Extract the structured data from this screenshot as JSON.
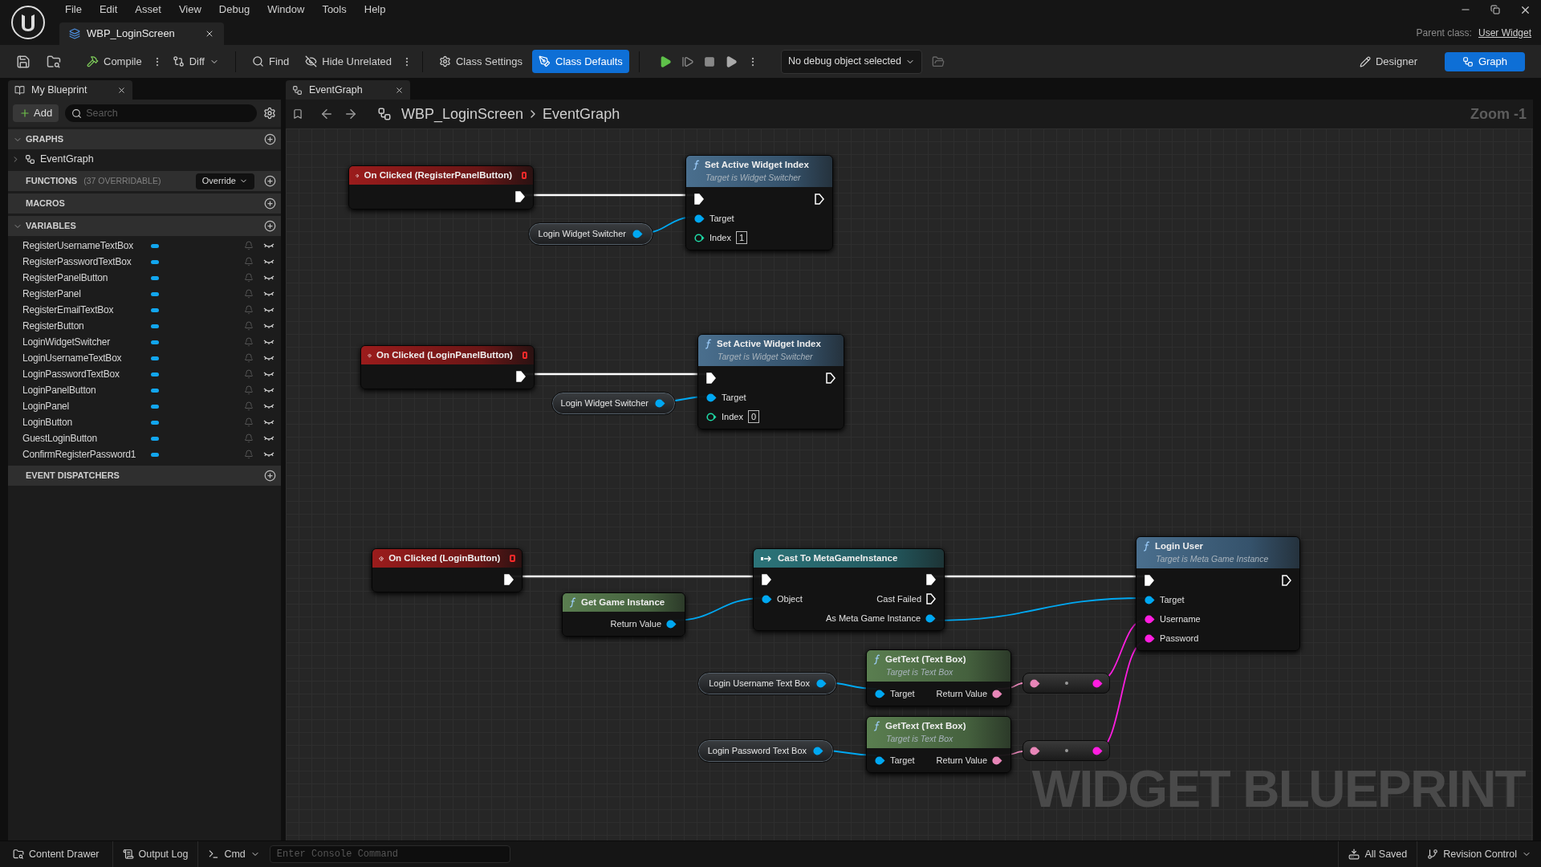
{
  "menu": [
    "File",
    "Edit",
    "Asset",
    "View",
    "Debug",
    "Window",
    "Tools",
    "Help"
  ],
  "document_tab": {
    "title": "WBP_LoginScreen"
  },
  "parent_class": {
    "label": "Parent class:",
    "value": "User Widget"
  },
  "toolbar": [
    {
      "label": "Compile",
      "selected": false
    },
    {
      "label": "Diff",
      "selected": false
    },
    {
      "label": "Find",
      "selected": false
    },
    {
      "label": "Hide Unrelated",
      "selected": false
    },
    {
      "label": "Class Settings",
      "selected": false
    },
    {
      "label": "Class Defaults",
      "selected": true
    }
  ],
  "debug_dropdown": {
    "value": "No debug object selected"
  },
  "modes": [
    {
      "label": "Designer",
      "selected": false
    },
    {
      "label": "Graph",
      "selected": true
    }
  ],
  "my_blueprint": {
    "tab": "My Blueprint",
    "add_button": "Add",
    "search": {
      "placeholder": "Search"
    },
    "sections": [
      {
        "title": "GRAPHS",
        "expanded": true,
        "items": [
          {
            "label": "EventGraph",
            "expanded": false
          }
        ]
      },
      {
        "title": "FUNCTIONS",
        "note": "(37 OVERRIDABLE)",
        "button": "Override",
        "expanded": false
      },
      {
        "title": "MACROS",
        "expanded": false
      },
      {
        "title": "VARIABLES",
        "expanded": true,
        "items": [
          {
            "label": "RegisterUsernameTextBox"
          },
          {
            "label": "RegisterPasswordTextBox"
          },
          {
            "label": "RegisterPanelButton"
          },
          {
            "label": "RegisterPanel"
          },
          {
            "label": "RegisterEmailTextBox"
          },
          {
            "label": "RegisterButton"
          },
          {
            "label": "LoginWidgetSwitcher"
          },
          {
            "label": "LoginUsernameTextBox"
          },
          {
            "label": "LoginPasswordTextBox"
          },
          {
            "label": "LoginPanelButton"
          },
          {
            "label": "LoginPanel"
          },
          {
            "label": "LoginButton"
          },
          {
            "label": "GuestLoginButton"
          },
          {
            "label": "ConfirmRegisterPassword1"
          }
        ]
      },
      {
        "title": "EVENT DISPATCHERS",
        "expanded": false
      }
    ]
  },
  "graph_tab": {
    "title": "EventGraph"
  },
  "breadcrumb": [
    "WBP_LoginScreen",
    "EventGraph"
  ],
  "zoom": "Zoom -1",
  "nodes": [
    {
      "kind": "event",
      "title": "On Clicked (RegisterPanelButton)",
      "outputs": [
        {
          "kind": "exec",
          "connected": true
        }
      ]
    },
    {
      "kind": "variable",
      "title": "Login Widget Switcher",
      "outputs": [
        {
          "kind": "object",
          "connected": true
        }
      ]
    },
    {
      "kind": "function",
      "title": "Set Active Widget Index",
      "subtitle": "Target is Widget Switcher",
      "inputs": [
        {
          "kind": "exec",
          "connected": true
        },
        {
          "kind": "object",
          "label": "Target",
          "connected": true
        },
        {
          "kind": "int",
          "label": "Index",
          "value": "1",
          "connected": false
        }
      ],
      "outputs": [
        {
          "kind": "exec",
          "connected": false
        }
      ]
    },
    {
      "kind": "event",
      "title": "On Clicked (LoginPanelButton)",
      "outputs": [
        {
          "kind": "exec",
          "connected": true
        }
      ]
    },
    {
      "kind": "variable",
      "title": "Login Widget Switcher",
      "outputs": [
        {
          "kind": "object",
          "connected": true
        }
      ]
    },
    {
      "kind": "function",
      "title": "Set Active Widget Index",
      "subtitle": "Target is Widget Switcher",
      "inputs": [
        {
          "kind": "exec",
          "connected": true
        },
        {
          "kind": "object",
          "label": "Target",
          "connected": true
        },
        {
          "kind": "int",
          "label": "Index",
          "value": "0",
          "connected": false
        }
      ],
      "outputs": [
        {
          "kind": "exec",
          "connected": false
        }
      ]
    },
    {
      "kind": "event",
      "title": "On Clicked (LoginButton)",
      "outputs": [
        {
          "kind": "exec",
          "connected": true
        }
      ]
    },
    {
      "kind": "pure",
      "title": "Get Game Instance",
      "outputs": [
        {
          "kind": "object",
          "label": "Return Value",
          "connected": true
        }
      ]
    },
    {
      "kind": "cast",
      "title": "Cast To MetaGameInstance",
      "inputs": [
        {
          "kind": "exec",
          "connected": true
        },
        {
          "kind": "object",
          "label": "Object",
          "connected": true
        }
      ],
      "outputs": [
        {
          "kind": "exec",
          "connected": true
        },
        {
          "kind": "exec",
          "label": "Cast Failed",
          "connected": false
        },
        {
          "kind": "object",
          "label": "As Meta Game Instance",
          "connected": true
        }
      ]
    },
    {
      "kind": "function",
      "title": "Login User",
      "subtitle": "Target is Meta Game Instance",
      "inputs": [
        {
          "kind": "exec",
          "connected": true
        },
        {
          "kind": "object",
          "label": "Target",
          "connected": true
        },
        {
          "kind": "string",
          "label": "Username",
          "connected": true
        },
        {
          "kind": "string",
          "label": "Password",
          "connected": true
        }
      ],
      "outputs": [
        {
          "kind": "exec",
          "connected": false
        }
      ]
    },
    {
      "kind": "variable",
      "title": "Login Username Text Box",
      "outputs": [
        {
          "kind": "object",
          "connected": true
        }
      ]
    },
    {
      "kind": "pure",
      "title": "GetText (Text Box)",
      "subtitle": "Target is Text Box",
      "inputs": [
        {
          "kind": "object",
          "label": "Target",
          "connected": true
        }
      ],
      "outputs": [
        {
          "kind": "text",
          "label": "Return Value",
          "connected": true
        }
      ]
    },
    {
      "kind": "reroute",
      "inputs": [
        {
          "kind": "text",
          "connected": true
        }
      ],
      "outputs": [
        {
          "kind": "string",
          "connected": true
        }
      ]
    },
    {
      "kind": "variable",
      "title": "Login Password Text Box",
      "outputs": [
        {
          "kind": "object",
          "connected": true
        }
      ]
    },
    {
      "kind": "pure",
      "title": "GetText (Text Box)",
      "subtitle": "Target is Text Box",
      "inputs": [
        {
          "kind": "object",
          "label": "Target",
          "connected": true
        }
      ],
      "outputs": [
        {
          "kind": "text",
          "label": "Return Value",
          "connected": true
        }
      ]
    },
    {
      "kind": "reroute",
      "inputs": [
        {
          "kind": "text",
          "connected": true
        }
      ],
      "outputs": [
        {
          "kind": "string",
          "connected": true
        }
      ]
    }
  ],
  "graph_label": "WIDGET BLUEPRINT",
  "status_bar": {
    "content_drawer": "Content Drawer",
    "output_log": "Output Log",
    "cmd": "Cmd",
    "console": {
      "placeholder": "Enter Console Command"
    },
    "saved": "All Saved",
    "revision": "Revision Control"
  }
}
